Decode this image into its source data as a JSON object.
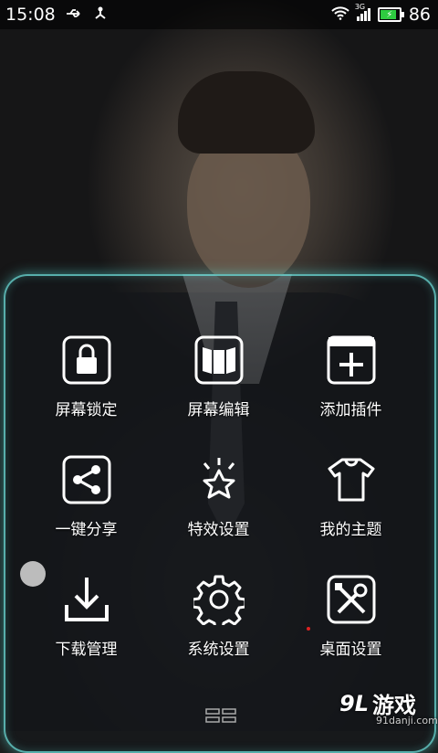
{
  "statusbar": {
    "time": "15:08",
    "network_type": "3G",
    "battery_level": "86",
    "battery_fraction": 0.86
  },
  "menu": {
    "items": [
      {
        "label": "屏幕锁定",
        "icon": "lock-icon"
      },
      {
        "label": "屏幕编辑",
        "icon": "panels-icon"
      },
      {
        "label": "添加插件",
        "icon": "add-widget-icon"
      },
      {
        "label": "一键分享",
        "icon": "share-icon"
      },
      {
        "label": "特效设置",
        "icon": "star-effects-icon"
      },
      {
        "label": "我的主题",
        "icon": "shirt-icon"
      },
      {
        "label": "下载管理",
        "icon": "download-icon"
      },
      {
        "label": "系统设置",
        "icon": "gear-icon"
      },
      {
        "label": "桌面设置",
        "icon": "tools-icon"
      }
    ]
  },
  "watermark": {
    "brand": "游戏",
    "number": "9L",
    "domain": "91danji.com"
  }
}
